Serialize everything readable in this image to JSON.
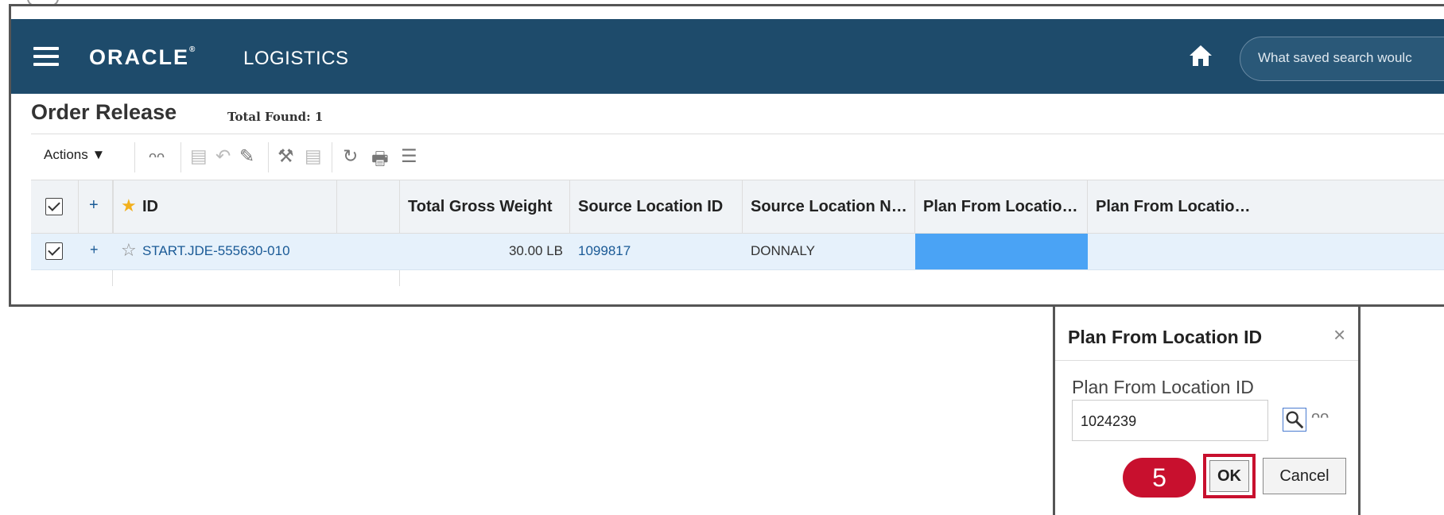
{
  "header": {
    "brand": "ORACLE",
    "product": "LOGISTICS",
    "search_placeholder": "What saved search woulc"
  },
  "page": {
    "title": "Order Release",
    "total_found": "Total Found: 1"
  },
  "toolbar": {
    "actions_label": "Actions ▼"
  },
  "grid": {
    "columns": [
      "ID",
      "Total Gross Weight",
      "Source Location ID",
      "Source Location N…",
      "Plan From Locatio…",
      "Plan From Locatio…"
    ],
    "rows": [
      {
        "id": "START.JDE-555630-010",
        "total_gross_weight": "30.00 LB",
        "source_location_id": "1099817",
        "source_location_name": "DONNALY"
      }
    ]
  },
  "dialog": {
    "title": "Plan From Location ID",
    "close": "×",
    "field_label": "Plan From Location ID",
    "field_value": "1024239",
    "ok_label": "OK",
    "cancel_label": "Cancel"
  },
  "annotation": {
    "step": "5"
  },
  "colors": {
    "header_bg": "#1e4b6b",
    "highlight": "#4aa3f5",
    "annotation_red": "#c8102e"
  }
}
